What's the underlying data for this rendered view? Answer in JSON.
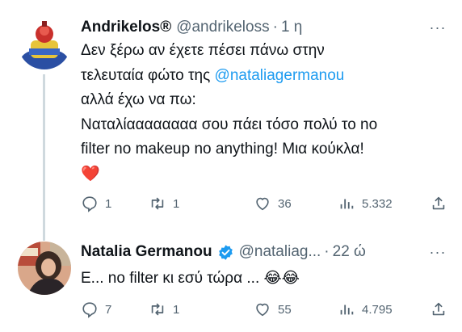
{
  "tweet1": {
    "display_name": "Andrikelos®",
    "handle": "@andrikeloss",
    "separator": "·",
    "time": "1 η",
    "text_line1": "Δεν ξέρω αν έχετε πέσει πάνω στην",
    "text_line2_prefix": "τελευταία φώτο της ",
    "mention": "@nataliagermanou",
    "text_line3": "αλλά έχω να πω:",
    "text_line4": "Ναταλίαααααααα σου πάει τόσο πολύ το no",
    "text_line5": "filter no makeup no anything! Μια κούκλα!",
    "emoji_line": "❤️",
    "stats": {
      "replies": "1",
      "retweets": "1",
      "likes": "36",
      "views": "5.332"
    }
  },
  "tweet2": {
    "display_name": "Natalia Germanou",
    "handle": "@nataliag...",
    "separator": "·",
    "time": "22 ώ",
    "text": "Ε... no filter κι εσύ τώρα ... 😂😂",
    "stats": {
      "replies": "7",
      "retweets": "1",
      "likes": "55",
      "views": "4.795"
    }
  },
  "more_label": "···",
  "colors": {
    "text": "#0f1419",
    "secondary": "#536471",
    "link": "#1d9bf0",
    "verified": "#1d9bf0",
    "heart": "#e0245e",
    "thread_line": "#cfd9de"
  },
  "icons": [
    "reply-icon",
    "retweet-icon",
    "like-icon",
    "views-icon",
    "share-icon",
    "verified-badge-icon",
    "more-icon"
  ]
}
